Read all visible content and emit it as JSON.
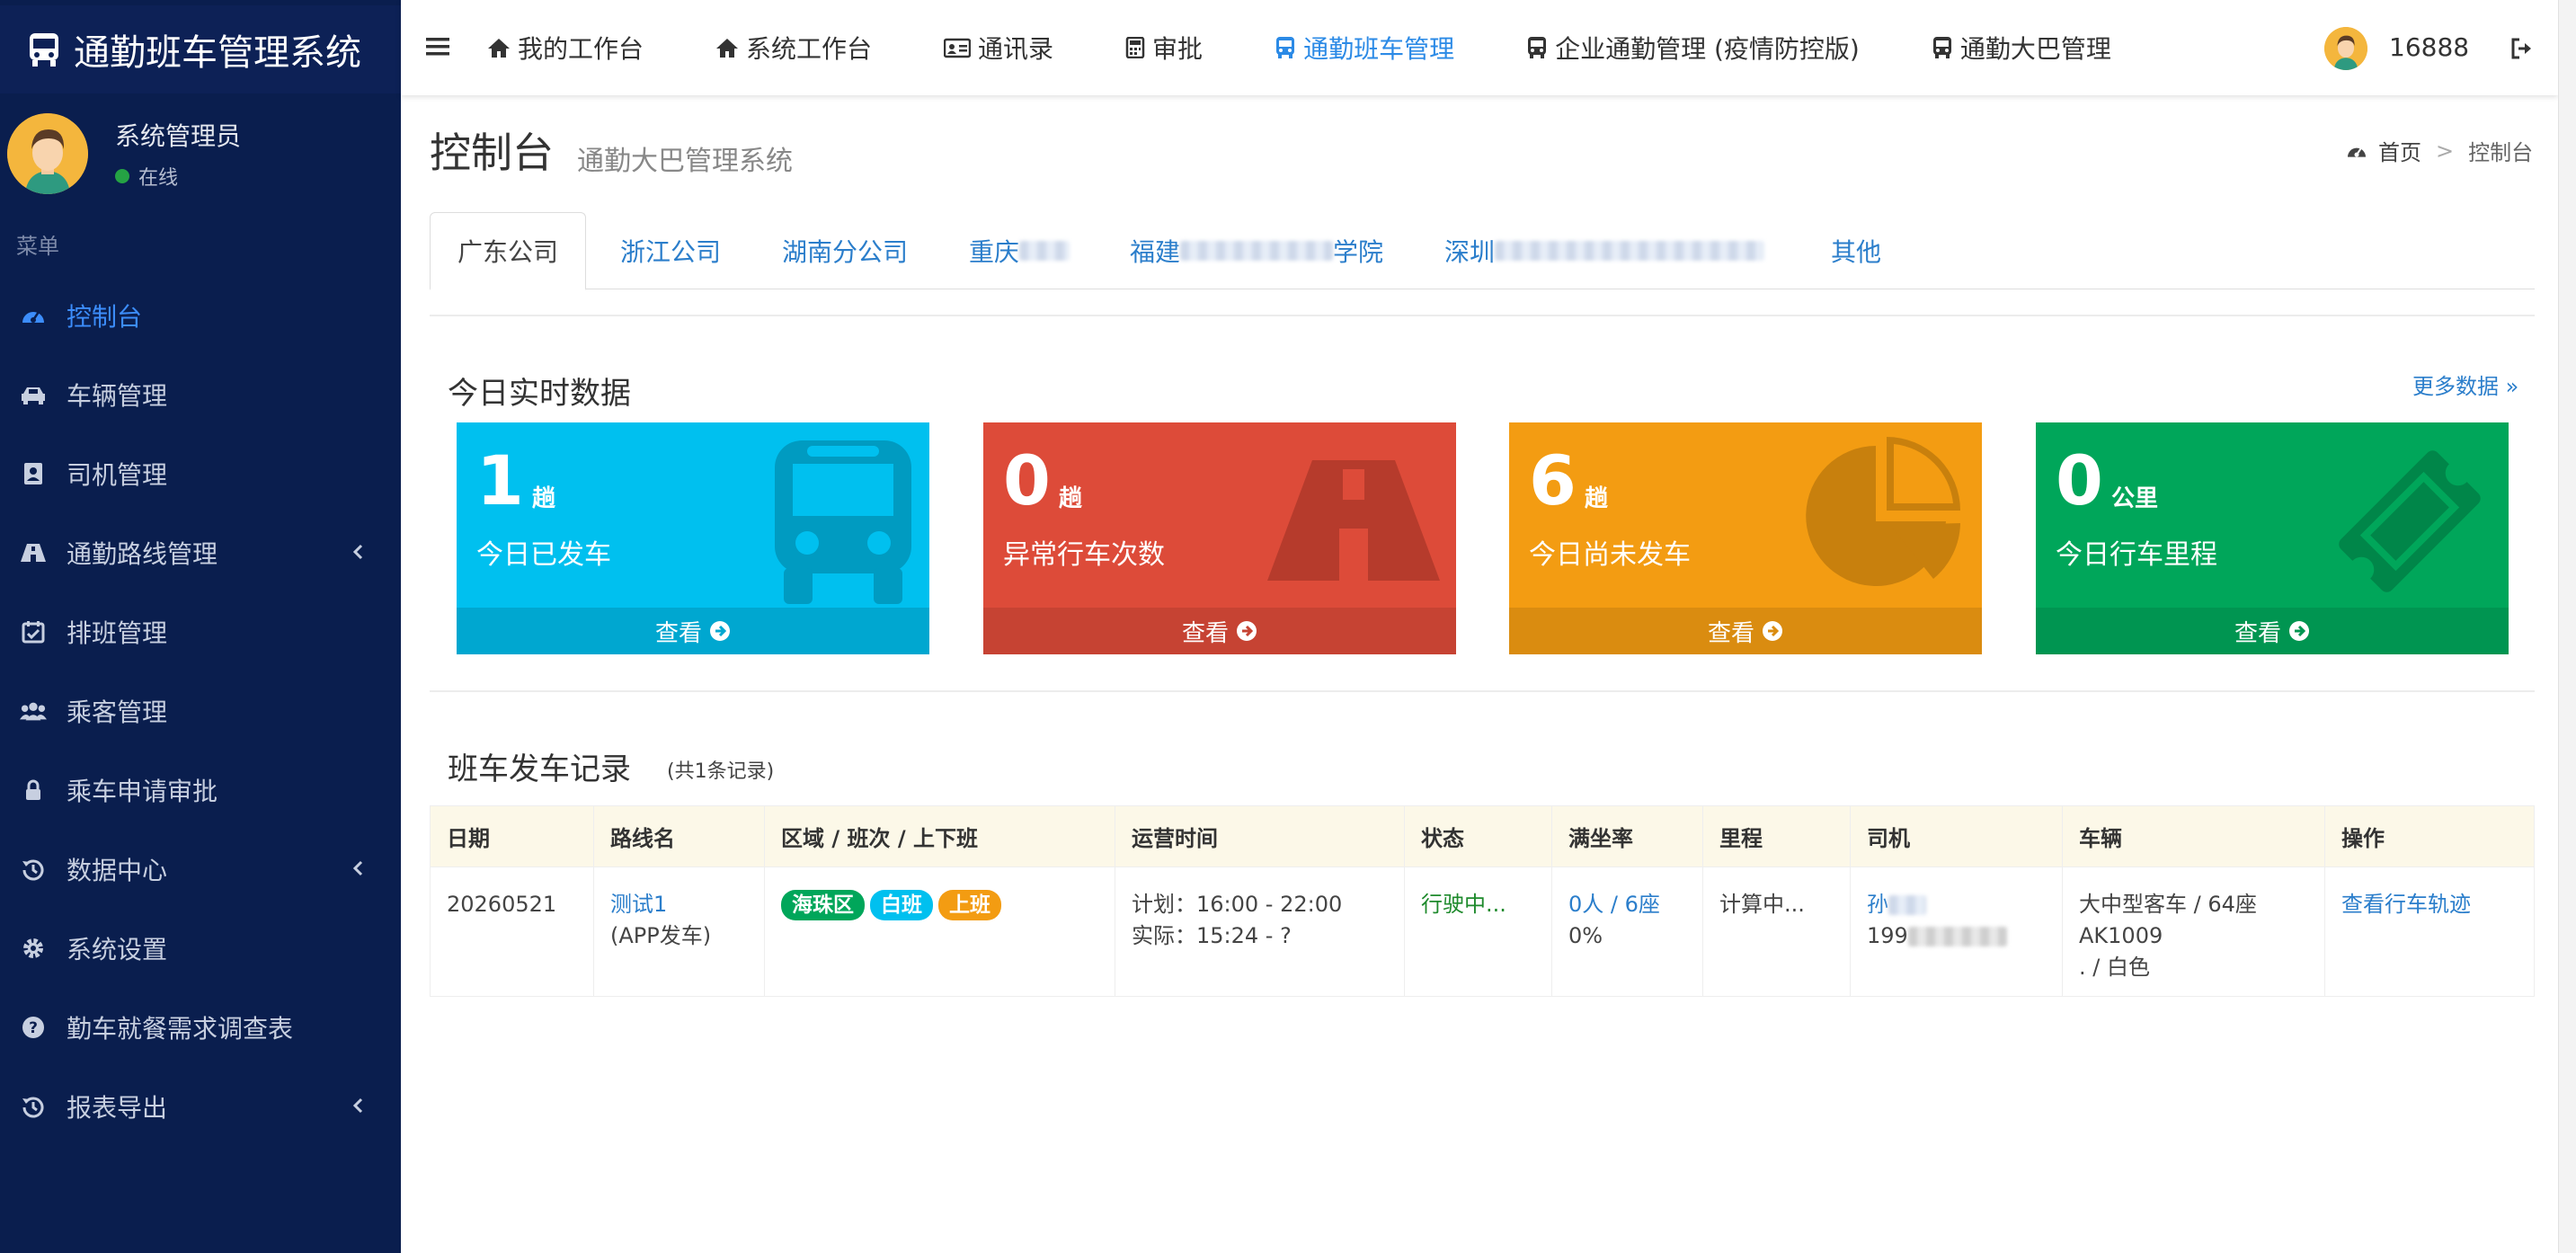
{
  "app": {
    "title": "通勤班车管理系统"
  },
  "sidebar": {
    "user_name": "系统管理员",
    "status": "在线",
    "menu_header": "菜单",
    "items": [
      {
        "label": "控制台",
        "icon": "dashboard-icon",
        "active": true
      },
      {
        "label": "车辆管理",
        "icon": "car-icon"
      },
      {
        "label": "司机管理",
        "icon": "address-book-icon"
      },
      {
        "label": "通勤路线管理",
        "icon": "road-icon",
        "has_children": true
      },
      {
        "label": "排班管理",
        "icon": "calendar-check-icon"
      },
      {
        "label": "乘客管理",
        "icon": "users-icon"
      },
      {
        "label": "乘车申请审批",
        "icon": "lock-icon"
      },
      {
        "label": "数据中心",
        "icon": "history-icon",
        "has_children": true
      },
      {
        "label": "系统设置",
        "icon": "gear-icon"
      },
      {
        "label": "勤车就餐需求调查表",
        "icon": "question-circle-icon"
      },
      {
        "label": "报表导出",
        "icon": "history-icon",
        "has_children": true
      }
    ]
  },
  "topnav": {
    "items": [
      {
        "label": "我的工作台",
        "icon": "home-icon"
      },
      {
        "label": "系统工作台",
        "icon": "home-icon"
      },
      {
        "label": "通讯录",
        "icon": "id-card-icon"
      },
      {
        "label": "审批",
        "icon": "calculator-icon"
      },
      {
        "label": "通勤班车管理",
        "icon": "bus-icon",
        "active": true
      },
      {
        "label": "企业通勤管理 (疫情防控版)",
        "icon": "bus-icon"
      },
      {
        "label": "通勤大巴管理",
        "icon": "bus-icon"
      }
    ],
    "user": "16888"
  },
  "page": {
    "title": "控制台",
    "subtitle": "通勤大巴管理系统"
  },
  "breadcrumb": {
    "home": "首页",
    "sep": ">",
    "current": "控制台"
  },
  "tabs": [
    "广东公司",
    "浙江公司",
    "湖南分公司",
    "重庆",
    "福建",
    "学院",
    "深圳",
    "其他"
  ],
  "realtime": {
    "title": "今日实时数据",
    "more": "更多数据 »",
    "boxes": [
      {
        "value": "1",
        "unit": "趟",
        "label": "今日已发车",
        "footer": "查看",
        "color": "#00c0ef",
        "foot_color": "#00a7d0",
        "icon": "bus-icon"
      },
      {
        "value": "0",
        "unit": "趟",
        "label": "异常行车次数",
        "footer": "查看",
        "color": "#dd4b39",
        "foot_color": "#c64333",
        "icon": "road-icon"
      },
      {
        "value": "6",
        "unit": "趟",
        "label": "今日尚未发车",
        "footer": "查看",
        "color": "#f39c12",
        "foot_color": "#da8c10",
        "icon": "pie-chart-icon"
      },
      {
        "value": "0",
        "unit": "公里",
        "label": "今日行车里程",
        "footer": "查看",
        "color": "#00a65a",
        "foot_color": "#009551",
        "icon": "ticket-icon"
      }
    ]
  },
  "records": {
    "title": "班车发车记录",
    "count": "(共1条记录)",
    "columns": [
      "日期",
      "路线名",
      "区域 / 班次 / 上下班",
      "运营时间",
      "状态",
      "满坐率",
      "里程",
      "司机",
      "车辆",
      "操作"
    ],
    "rows": [
      {
        "date": "20260521",
        "route": "测试1",
        "route_note": "(APP发车)",
        "tags": [
          {
            "text": "海珠区",
            "color": "#00a65a"
          },
          {
            "text": "白班",
            "color": "#00c0ef"
          },
          {
            "text": "上班",
            "color": "#f39c12"
          }
        ],
        "plan": "计划：16:00 - 22:00",
        "actual": "实际：15:24 - ?",
        "status": "行驶中...",
        "load": "0人 / 6座",
        "load_pct": "0%",
        "mileage": "计算中...",
        "driver": "孙",
        "driver_phone": "199",
        "vehicle_1": "大中型客车 / 64座",
        "vehicle_2": "AK1009",
        "vehicle_3": ". / 白色",
        "action": "查看行车轨迹"
      }
    ]
  }
}
